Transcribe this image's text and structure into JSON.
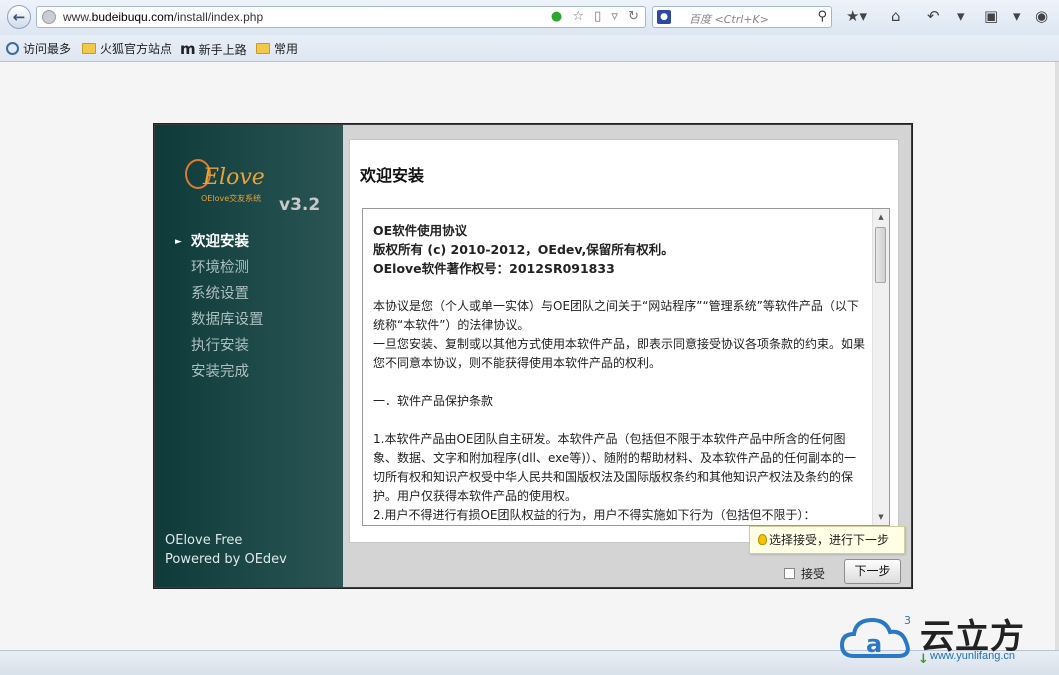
{
  "browser": {
    "url_prefix": "www.",
    "url_domain": "budeibuqu.com",
    "url_path": "/install/index.php",
    "search_placeholder": "百度 <Ctrl+K>",
    "bookmarks": [
      "访问最多",
      "火狐官方站点",
      "新手上路",
      "常用"
    ]
  },
  "installer": {
    "version": "v3.2",
    "logo_word": "Elove",
    "logo_sub": "OElove交友系统",
    "nav": [
      "欢迎安装",
      "环境检测",
      "系统设置",
      "数据库设置",
      "执行安装",
      "安装完成"
    ],
    "active_index": 0,
    "footer_line1": "OElove Free",
    "footer_line2": "Powered by OEdev",
    "heading": "欢迎安装",
    "license": {
      "title1": "OE软件使用协议",
      "title2": "版权所有 (c) 2010-2012，OEdev,保留所有权利。",
      "title3": "OElove软件著作权号：2012SR091833",
      "p1": "本协议是您（个人或单一实体）与OE团队之间关于“网站程序”“管理系统”等软件产品（以下统称“本软件”）的法律协议。",
      "p2": "一旦您安装、复制或以其他方式使用本软件产品，即表示同意接受协议各项条款的约束。如果您不同意本协议，则不能获得使用本软件产品的权利。",
      "p3": "一．软件产品保护条款",
      "p4": "1.本软件产品由OE团队自主研发。本软件产品（包括但不限于本软件产品中所含的任何图象、数据、文字和附加程序(dll、exe等)）、随附的帮助材料、及本软件产品的任何副本的一切所有权和知识产权受中华人民共和国版权法及国际版权条约和其他知识产权法及条约的保护。用户仅获得本软件产品的使用权。",
      "p5": "2.用户不得进行有损OE团队权益的行为，用户不得实施如下行为（包括但不限于）："
    },
    "tooltip": "选择接受，进行下一步",
    "accept_label": "接受",
    "next_label": "下一步"
  },
  "watermark": {
    "text": "云立方",
    "url": "www.yunlifang.cn",
    "sup": "3"
  }
}
